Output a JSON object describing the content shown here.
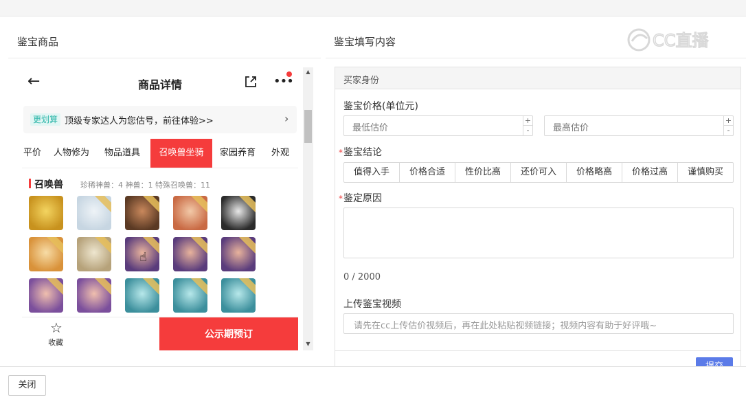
{
  "left_panel": {
    "title": "鉴宝商品"
  },
  "right_panel": {
    "title": "鉴宝填写内容"
  },
  "watermark": {
    "text": "CC直播"
  },
  "phone": {
    "nav": {
      "back": "←",
      "title": "商品详情",
      "share_icon": "share-icon",
      "more": "•••"
    },
    "promo": {
      "tag": "更划算",
      "text": "顶级专家达人为您估号，前往体验>>",
      "arrow": "›"
    },
    "tabs": [
      {
        "label": "平价",
        "active": false
      },
      {
        "label": "人物修为",
        "active": false
      },
      {
        "label": "物品道具",
        "active": false
      },
      {
        "label": "召唤兽坐骑",
        "active": true
      },
      {
        "label": "家园养育",
        "active": false
      },
      {
        "label": "外观",
        "active": false
      }
    ],
    "summon": {
      "title": "召唤兽",
      "stats": "珍稀神兽：4   神兽：1   特殊召唤兽：11",
      "tiles": [
        {
          "colors": [
            "#c8921e",
            "#f3d460"
          ],
          "tagged": false
        },
        {
          "colors": [
            "#c7d6e2",
            "#eef3f7"
          ],
          "tagged": true
        },
        {
          "colors": [
            "#5b3a24",
            "#c9885c"
          ],
          "tagged": true
        },
        {
          "colors": [
            "#c96a44",
            "#f2c9a8"
          ],
          "tagged": true
        },
        {
          "colors": [
            "#2b2b2b",
            "#e8e8e8"
          ],
          "tagged": true
        },
        {
          "colors": [
            "#d9923a",
            "#f7dca6"
          ],
          "tagged": true
        },
        {
          "colors": [
            "#b6a27a",
            "#eee6cf"
          ],
          "tagged": true
        },
        {
          "colors": [
            "#5a3c7c",
            "#e8b39c"
          ],
          "tagged": true
        },
        {
          "colors": [
            "#5a3c7c",
            "#e8b39c"
          ],
          "tagged": true
        },
        {
          "colors": [
            "#5a3c7c",
            "#e8b39c"
          ],
          "tagged": true
        },
        {
          "colors": [
            "#7b4f9c",
            "#f0bfae"
          ],
          "tagged": true
        },
        {
          "colors": [
            "#7b4f9c",
            "#f0bfae"
          ],
          "tagged": true
        },
        {
          "colors": [
            "#3c8f9c",
            "#b7e8ea"
          ],
          "tagged": true
        },
        {
          "colors": [
            "#3c8f9c",
            "#b7e8ea"
          ],
          "tagged": true
        },
        {
          "colors": [
            "#3c8f9c",
            "#b7e8ea"
          ],
          "tagged": true
        }
      ]
    },
    "bottom": {
      "fav_label": "收藏",
      "reserve": "公示期预订"
    }
  },
  "form": {
    "section": "买家身份",
    "price_label": "鉴宝价格(单位元)",
    "min_placeholder": "最低估价",
    "max_placeholder": "最高估价",
    "spin_up": "+",
    "spin_down": "-",
    "conclusion_label": "鉴宝结论",
    "required_mark": "*",
    "conclusions": [
      "值得入手",
      "价格合适",
      "性价比高",
      "还价可入",
      "价格略高",
      "价格过高",
      "谨慎购买"
    ],
    "reason_label": "鉴定原因",
    "counter": "0 / 2000",
    "video_label": "上传鉴宝视频",
    "video_placeholder": "请先在cc上传估价视频后，再在此处粘贴视频链接；视频内容有助于好评哦~",
    "submit": "提交"
  },
  "footer": {
    "close": "关闭"
  },
  "colors": {
    "accent_red": "#f53c3c",
    "primary_blue": "#5b7be8",
    "promo_teal": "#2bb5a8"
  }
}
